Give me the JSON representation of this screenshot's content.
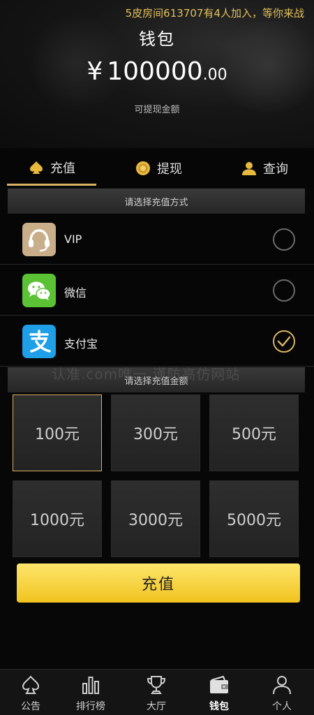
{
  "header": {
    "marquee": "5皮房间613707有4人加入，等你来战",
    "title": "钱包",
    "balance_currency": "¥",
    "balance_integer": "100000",
    "balance_decimal": ".00",
    "balance_caption": "可提现金额"
  },
  "tabs": [
    {
      "label": "充值",
      "icon": "spade-icon",
      "active": true
    },
    {
      "label": "提现",
      "icon": "coin-icon",
      "active": false
    },
    {
      "label": "查询",
      "icon": "user-icon",
      "active": false
    }
  ],
  "method_section_title": "请选择充值方式",
  "methods": [
    {
      "label": "VIP",
      "icon": "headset-icon",
      "checked": false
    },
    {
      "label": "微信",
      "icon": "wechat-icon",
      "checked": false
    },
    {
      "label": "支付宝",
      "icon": "alipay-icon",
      "checked": true
    }
  ],
  "watermark": "认准.com唯一 谨防高仿网站",
  "amount_section_title": "请选择充值金额",
  "amounts": [
    {
      "label": "100元",
      "selected": true
    },
    {
      "label": "300元",
      "selected": false
    },
    {
      "label": "500元",
      "selected": false
    },
    {
      "label": "1000元",
      "selected": false
    },
    {
      "label": "3000元",
      "selected": false
    },
    {
      "label": "5000元",
      "selected": false
    }
  ],
  "recharge_button": "充值",
  "bottom_nav": [
    {
      "label": "公告",
      "icon": "spade-outline-icon",
      "active": false
    },
    {
      "label": "排行榜",
      "icon": "bar-chart-icon",
      "active": false
    },
    {
      "label": "大厅",
      "icon": "trophy-icon",
      "active": false
    },
    {
      "label": "钱包",
      "icon": "wallet-icon",
      "active": true
    },
    {
      "label": "个人",
      "icon": "person-icon",
      "active": false
    }
  ],
  "colors": {
    "accent_gold": "#d9b363",
    "button_yellow": "#f1c31f",
    "marquee_text": "#e3c05a",
    "background": "#070707"
  }
}
